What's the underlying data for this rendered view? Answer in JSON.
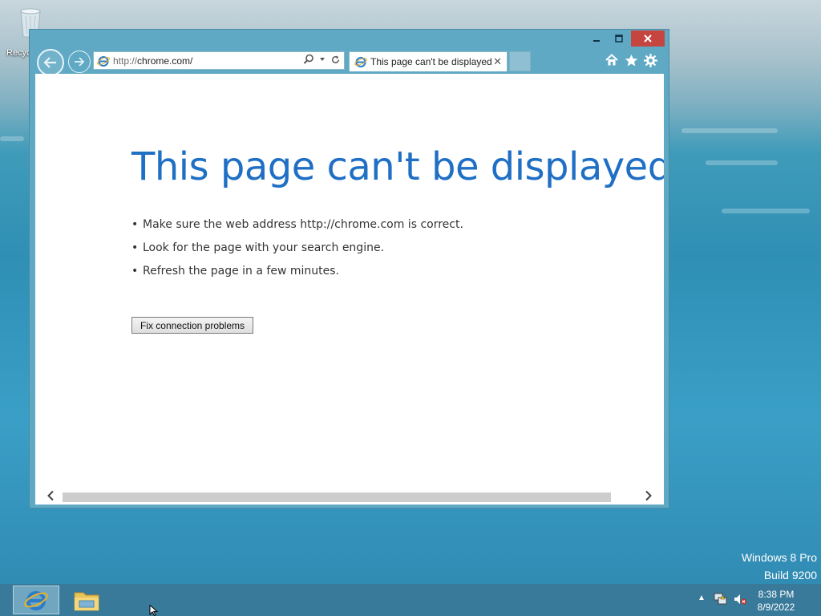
{
  "desktop": {
    "recycle_label": "Recyc",
    "watermark_line1": "Windows 8 Pro",
    "watermark_line2": "Build 9200"
  },
  "browser": {
    "address_protocol": "http://",
    "address_host": "chrome.com/",
    "tab_title": "This page can't be displayed",
    "tab_close": "✕"
  },
  "page": {
    "title": "This page can't be displayed",
    "bullets": [
      "Make sure the web address http://chrome.com is correct.",
      "Look for the page with your search engine.",
      "Refresh the page in a few minutes."
    ],
    "fix_button": "Fix connection problems"
  },
  "taskbar": {
    "time": "8:38 PM",
    "date": "8/9/2022"
  },
  "colors": {
    "accent": "#1f6fc5",
    "window_frame": "#5fa9c4",
    "close_button": "#c7453f"
  },
  "icons": [
    "recycle-bin-icon",
    "back-icon",
    "forward-icon",
    "ie-icon",
    "search-icon",
    "refresh-icon",
    "home-icon",
    "star-icon",
    "gear-icon",
    "folder-icon",
    "network-icon",
    "volume-muted-icon"
  ]
}
